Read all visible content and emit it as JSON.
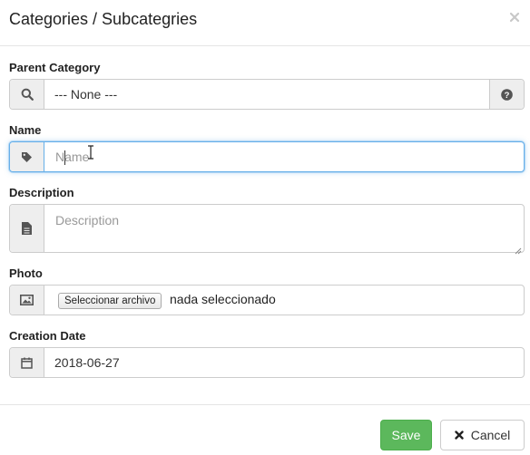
{
  "header": {
    "title": "Categories / Subcategries"
  },
  "form": {
    "parent_category": {
      "label": "Parent Category",
      "selected": "--- None ---",
      "icon": "search-icon",
      "help_icon": "question-circle-icon"
    },
    "name": {
      "label": "Name",
      "placeholder": "Name",
      "value": "",
      "icon": "tag-icon"
    },
    "description": {
      "label": "Description",
      "placeholder": "Description",
      "value": "",
      "icon": "file-icon"
    },
    "photo": {
      "label": "Photo",
      "button_label": "Seleccionar archivo",
      "status": "nada seleccionado",
      "icon": "image-icon"
    },
    "creation_date": {
      "label": "Creation Date",
      "value": "2018-06-27",
      "icon": "calendar-icon"
    }
  },
  "footer": {
    "save_label": "Save",
    "cancel_label": "Cancel"
  },
  "colors": {
    "save": "#5cb85c",
    "focus": "#66afe9",
    "addon_bg": "#eeeeee"
  }
}
